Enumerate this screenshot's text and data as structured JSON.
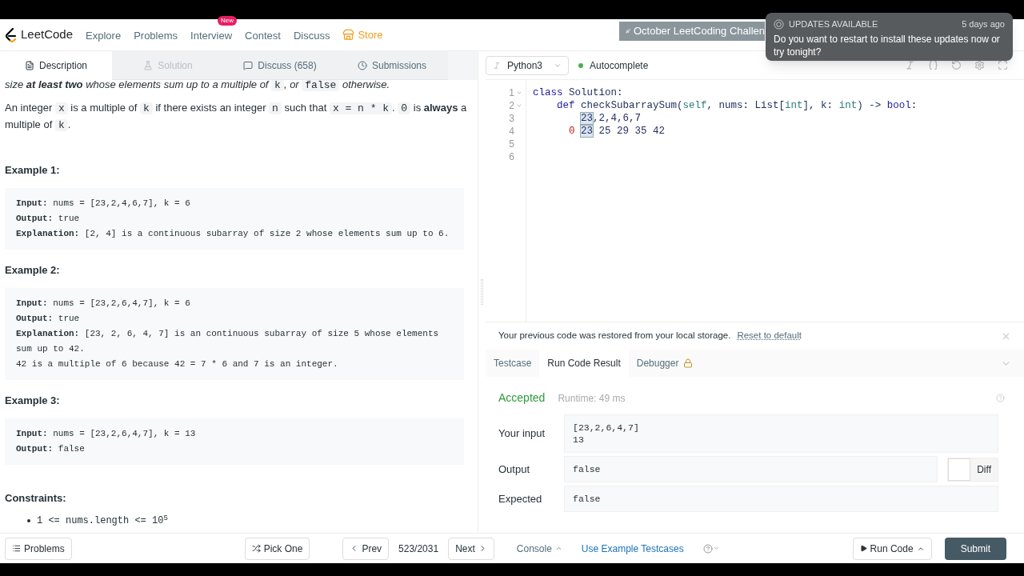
{
  "nav": {
    "logo": "LeetCode",
    "items": [
      {
        "label": "Explore",
        "kind": "link"
      },
      {
        "label": "Problems",
        "kind": "link"
      },
      {
        "label": "Interview",
        "kind": "link",
        "badge": "New"
      },
      {
        "label": "Contest",
        "kind": "link"
      },
      {
        "label": "Discuss",
        "kind": "link"
      },
      {
        "label": "Store",
        "kind": "store"
      }
    ]
  },
  "banner": "October LeetCoding Challen",
  "notification": {
    "title": "UPDATES AVAILABLE",
    "time": "5 days ago",
    "message": "Do you want to restart to install these updates now or try tonight?"
  },
  "description_tabs": [
    {
      "label": "Description",
      "selected": true,
      "disabled": false
    },
    {
      "label": "Solution",
      "selected": false,
      "disabled": true
    },
    {
      "label": "Discuss (658)",
      "selected": false,
      "disabled": false
    },
    {
      "label": "Submissions",
      "selected": false,
      "disabled": false
    }
  ],
  "description": {
    "paragraphs": [
      [
        {
          "kind": "italic",
          "text": "size **at least two** whose elements sum up to a multiple of "
        },
        {
          "kind": "code",
          "text": "k"
        },
        {
          "kind": "italic",
          "text": ", or "
        },
        {
          "kind": "code",
          "text": "false"
        },
        {
          "kind": "italic",
          "text": " otherwise."
        }
      ],
      [
        {
          "kind": "text",
          "text": "An integer "
        },
        {
          "kind": "code",
          "text": "x"
        },
        {
          "kind": "text",
          "text": " is a multiple of "
        },
        {
          "kind": "code",
          "text": "k"
        },
        {
          "kind": "text",
          "text": " if there exists an integer "
        },
        {
          "kind": "code",
          "text": "n"
        },
        {
          "kind": "text",
          "text": " such that "
        },
        {
          "kind": "code",
          "text": "x = n * k"
        },
        {
          "kind": "text",
          "text": ". "
        },
        {
          "kind": "code",
          "text": "0"
        },
        {
          "kind": "text",
          "text": " is **always** a multiple of "
        },
        {
          "kind": "code",
          "text": "k"
        },
        {
          "kind": "text",
          "text": "."
        }
      ]
    ],
    "examples": [
      {
        "title": "Example 1:",
        "lines": [
          {
            "label": "Input:",
            "text": " nums = [23,2,4,6,7], k = 6"
          },
          {
            "label": "Output:",
            "text": " true"
          },
          {
            "label": "Explanation:",
            "text": " [2, 4] is a continuous subarray of size 2 whose elements sum up to 6."
          }
        ]
      },
      {
        "title": "Example 2:",
        "lines": [
          {
            "label": "Input:",
            "text": " nums = [23,2,6,4,7], k = 6"
          },
          {
            "label": "Output:",
            "text": " true"
          },
          {
            "label": "Explanation:",
            "text": " [23, 2, 6, 4, 7] is an continuous subarray of size 5 whose elements sum up to 42."
          },
          {
            "text": "42 is a multiple of 6 because 42 = 7 * 6 and 7 is an integer."
          }
        ]
      },
      {
        "title": "Example 3:",
        "lines": [
          {
            "label": "Input:",
            "text": " nums = [23,2,6,4,7], k = 13"
          },
          {
            "label": "Output:",
            "text": " false"
          }
        ]
      }
    ],
    "constraints_title": "Constraints:",
    "constraints": [
      "1 <= nums.length <= 10$^{5}$"
    ]
  },
  "editor_toolbar": {
    "language": "Python3",
    "autocomplete": {
      "label": "Autocomplete",
      "on": true
    }
  },
  "code": [
    {
      "number": "1",
      "foldable": true,
      "kind": "top",
      "tokens": [
        {
          "kind": "keyword",
          "text": "class "
        },
        {
          "kind": "plain",
          "text": "Solution:"
        }
      ]
    },
    {
      "number": "2",
      "foldable": true,
      "kind": "method",
      "tokens": [
        {
          "kind": "keyword",
          "text": "def "
        },
        {
          "kind": "plain",
          "text": "checkSubarraySum("
        },
        {
          "kind": "builtin",
          "text": "self"
        },
        {
          "kind": "plain",
          "text": ", nums: List["
        },
        {
          "kind": "builtin",
          "text": "int"
        },
        {
          "kind": "plain",
          "text": "], k: "
        },
        {
          "kind": "builtin",
          "text": "int"
        },
        {
          "kind": "plain",
          "text": ") -> "
        },
        {
          "kind": "keyword",
          "text": "bool"
        },
        {
          "kind": "plain",
          "text": ":"
        }
      ]
    },
    {
      "number": "3",
      "foldable": false,
      "kind": "body",
      "tokens": [
        {
          "kind": "boxed",
          "text": "23"
        },
        {
          "kind": "plain",
          "text": ",2,4,6,7"
        }
      ]
    },
    {
      "number": "4",
      "foldable": false,
      "kind": "offset",
      "tokens": [
        {
          "kind": "number",
          "text": "0 "
        },
        {
          "kind": "boxed",
          "text": "23"
        },
        {
          "kind": "plain",
          "text": " 25 29 35 42"
        }
      ]
    },
    {
      "number": "5",
      "foldable": false,
      "kind": "blank"
    },
    {
      "number": "6",
      "foldable": false,
      "kind": "blank"
    }
  ],
  "notice": {
    "text": "Your previous code was restored from your local storage.",
    "link": "Reset to default"
  },
  "result_tabs": [
    {
      "label": "Testcase",
      "selected": false,
      "locked": false
    },
    {
      "label": "Run Code Result",
      "selected": true,
      "locked": false
    },
    {
      "label": "Debugger",
      "selected": false,
      "locked": true
    }
  ],
  "result": {
    "status": "Accepted",
    "runtime": "Runtime: 49 ms",
    "rows": [
      {
        "label": "Your input",
        "lines": [
          "[23,2,6,4,7]",
          "13"
        ]
      },
      {
        "label": "Output",
        "lines": [
          "false"
        ],
        "diff": {
          "label": "Diff",
          "on": false
        }
      },
      {
        "label": "Expected",
        "lines": [
          "false"
        ]
      }
    ]
  },
  "bottom_bar": {
    "problems": "Problems",
    "pick_one": "Pick One",
    "prev": "Prev",
    "position": "523/2031",
    "next": "Next",
    "console": "Console",
    "use_example": "Use Example Testcases",
    "run_code": "Run Code",
    "submit": "Submit"
  }
}
